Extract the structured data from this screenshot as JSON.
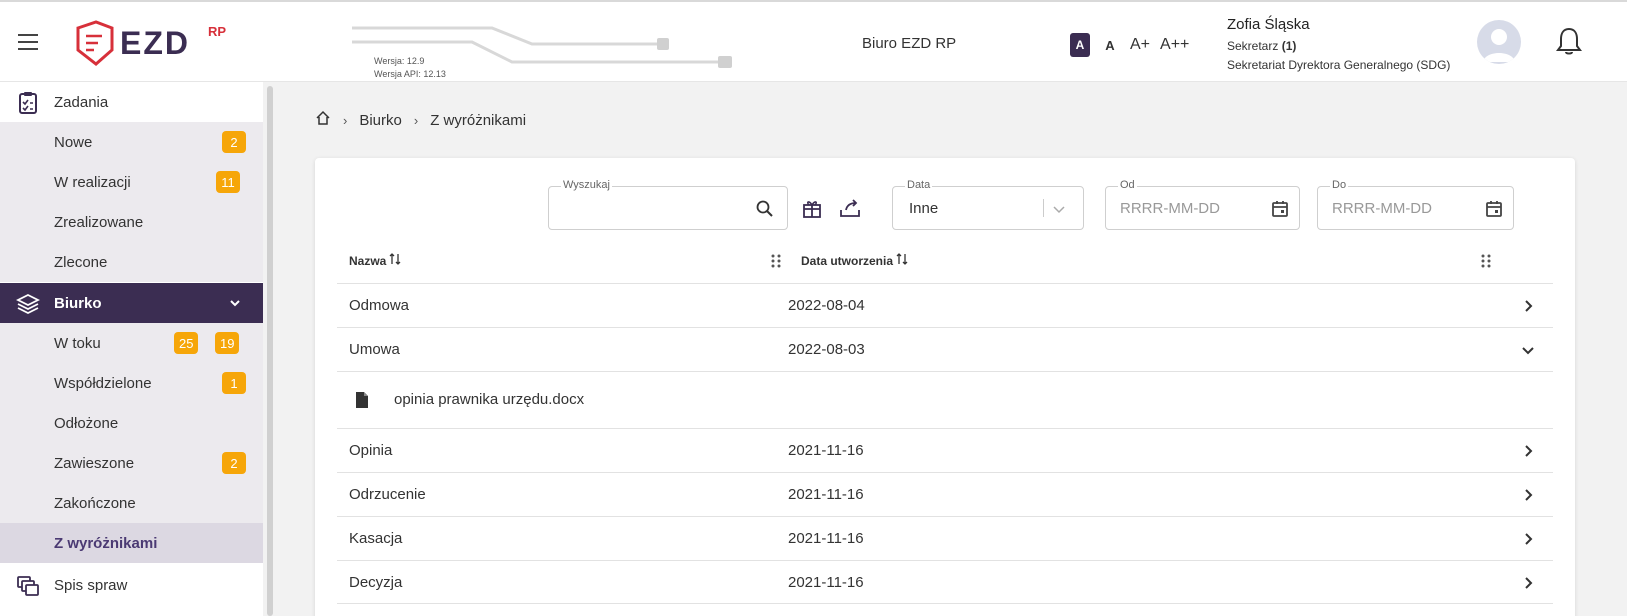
{
  "app": {
    "logo_text": "EZD",
    "logo_sup": "RP",
    "version": "Wersja: 12.9",
    "api_version": "Wersja API: 12.13",
    "office": "Biuro EZD RP"
  },
  "font_controls": [
    "A",
    "A",
    "A+",
    "A++"
  ],
  "user": {
    "name": "Zofia Śląska",
    "role": "Sekretarz",
    "role_count": "(1)",
    "department": "Sekretariat Dyrektora Generalnego (SDG)"
  },
  "sidebar": {
    "zadania": {
      "label": "Zadania",
      "items": [
        {
          "label": "Nowe",
          "badge": "2"
        },
        {
          "label": "W realizacji",
          "badge": "11"
        },
        {
          "label": "Zrealizowane"
        },
        {
          "label": "Zlecone"
        }
      ]
    },
    "biurko": {
      "label": "Biurko",
      "items": [
        {
          "label": "W toku",
          "badge": "25",
          "badge2": "19"
        },
        {
          "label": "Współdzielone",
          "badge": "1"
        },
        {
          "label": "Odłożone"
        },
        {
          "label": "Zawieszone",
          "badge": "2"
        },
        {
          "label": "Zakończone"
        },
        {
          "label": "Z wyróżnikami"
        }
      ]
    },
    "spis_spraw": {
      "label": "Spis spraw"
    }
  },
  "breadcrumb": [
    "Biurko",
    "Z wyróżnikami"
  ],
  "filters": {
    "search_label": "Wyszukaj",
    "date_label": "Data",
    "date_value": "Inne",
    "from_label": "Od",
    "from_placeholder": "RRRR-MM-DD",
    "to_label": "Do",
    "to_placeholder": "RRRR-MM-DD"
  },
  "table": {
    "col_name": "Nazwa",
    "col_date": "Data utworzenia",
    "rows": [
      {
        "name": "Odmowa",
        "date": "2022-08-04"
      },
      {
        "name": "Umowa",
        "date": "2022-08-03"
      },
      {
        "file": "opinia prawnika urzędu.docx"
      },
      {
        "name": "Opinia",
        "date": "2021-11-16"
      },
      {
        "name": "Odrzucenie",
        "date": "2021-11-16"
      },
      {
        "name": "Kasacja",
        "date": "2021-11-16"
      },
      {
        "name": "Decyzja",
        "date": "2021-11-16"
      }
    ]
  },
  "colors": {
    "primary": "#3b2d52",
    "badge": "#f6a609",
    "logo_red": "#d7303a"
  }
}
